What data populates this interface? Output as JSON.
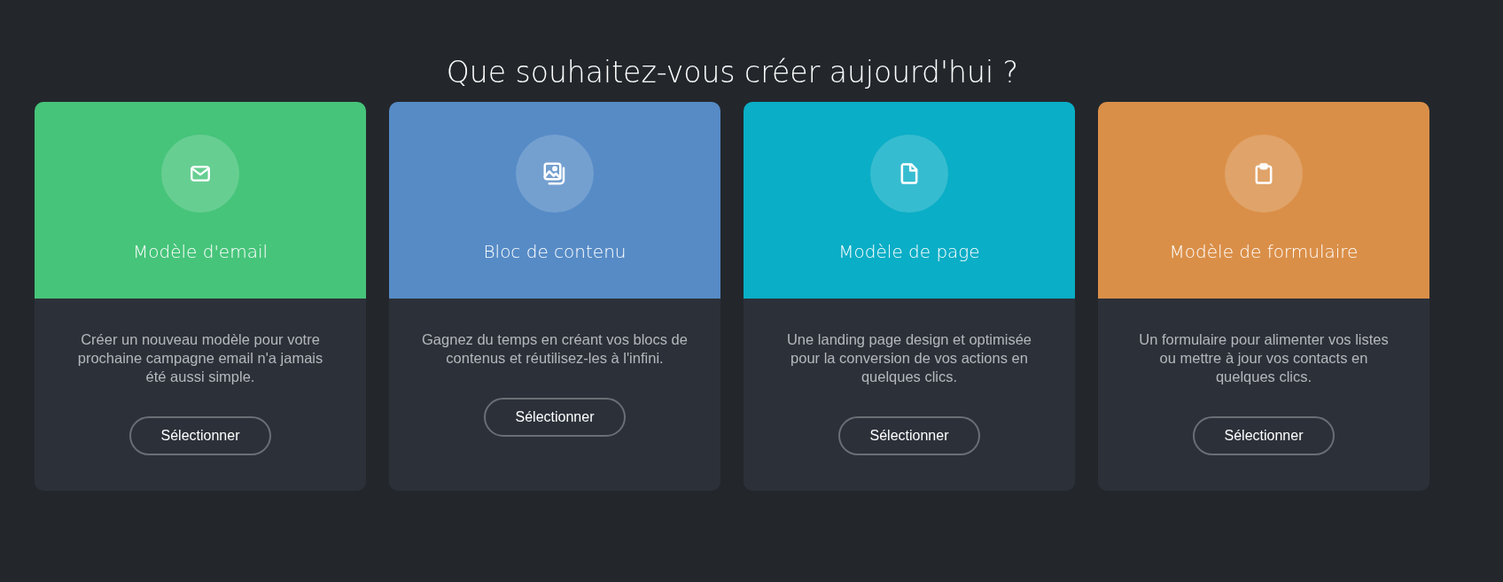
{
  "heading": "Que souhaitez-vous créer aujourd'hui ?",
  "cards": [
    {
      "kind": "email",
      "color": "#46c47a",
      "title": "Modèle d'email",
      "description": "Créer un nouveau modèle pour votre prochaine campagne email n'a jamais été aussi simple.",
      "button": "Sélectionner"
    },
    {
      "kind": "images",
      "color": "#568bc6",
      "title": "Bloc de contenu",
      "description": "Gagnez du temps en créant vos blocs de contenus et réutilisez-les à l'infini.",
      "button": "Sélectionner"
    },
    {
      "kind": "page",
      "color": "#0aaec6",
      "title": "Modèle de page",
      "description": "Une landing page design et optimisée pour la conversion de vos actions en quelques clics.",
      "button": "Sélectionner"
    },
    {
      "kind": "clipboard",
      "color": "#da8f48",
      "title": "Modèle de formulaire",
      "description": "Un formulaire pour alimenter vos listes ou mettre à jour vos contacts en quelques clics.",
      "button": "Sélectionner"
    }
  ]
}
